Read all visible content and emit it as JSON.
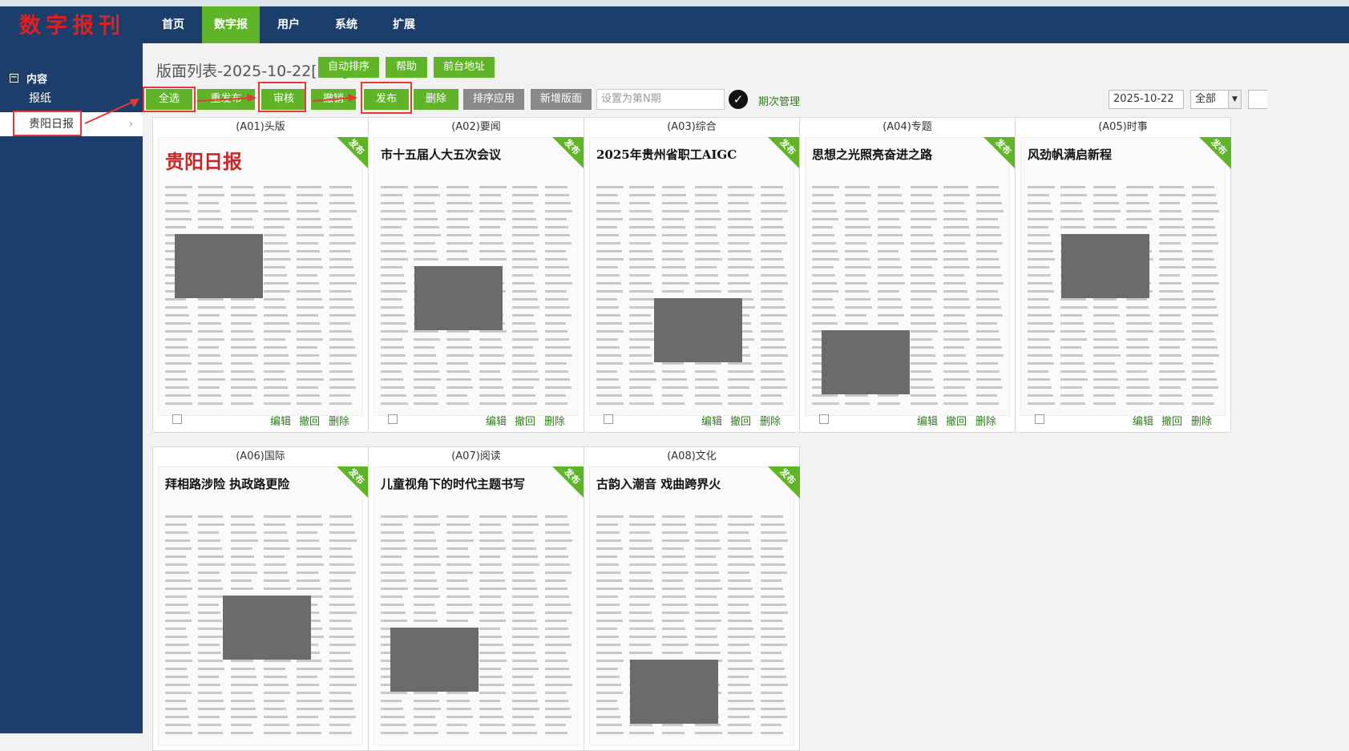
{
  "brand": {
    "logo_text": "数字报刊",
    "accent": "#5fb527",
    "nav_bg": "#1b3e6b"
  },
  "nav": {
    "items": [
      {
        "label": "首页",
        "active": false
      },
      {
        "label": "数字报",
        "active": true
      },
      {
        "label": "用户",
        "active": false
      },
      {
        "label": "系统",
        "active": false
      },
      {
        "label": "扩展",
        "active": false
      }
    ]
  },
  "sidebar": {
    "section_label": "内容",
    "items": [
      {
        "label": "报纸"
      },
      {
        "label": "贵阳日报",
        "active": true
      }
    ]
  },
  "main": {
    "title": "版面列表-2025-10-22[8版]",
    "header_buttons": {
      "auto_sort": "自动排序",
      "help": "帮助",
      "frontend_url": "前台地址"
    },
    "toolbar": {
      "select_all": "全选",
      "resend": "重发布",
      "review": "审核",
      "revoke": "撤销",
      "publish": "发布",
      "delete": "删除",
      "sort_apply": "排序应用",
      "add_page": "新增版面",
      "issue_placeholder": "设置为第N期",
      "issue_manage": "期次管理"
    },
    "filters": {
      "date": "2025-10-22",
      "scope": "全部"
    }
  },
  "card_actions": {
    "edit": "编辑",
    "withdraw": "撤回",
    "delete": "删除",
    "badge": "发布"
  },
  "pages": [
    {
      "title": "(A01)头版",
      "headline": "贵阳日报"
    },
    {
      "title": "(A02)要闻",
      "headline": "市十五届人大五次会议"
    },
    {
      "title": "(A03)综合",
      "headline": "2025年贵州省职工AIGC"
    },
    {
      "title": "(A04)专题",
      "headline": "思想之光照亮奋进之路"
    },
    {
      "title": "(A05)时事",
      "headline": "风劲帆满启新程"
    },
    {
      "title": "(A06)国际",
      "headline": "拜相路涉险 执政路更险"
    },
    {
      "title": "(A07)阅读",
      "headline": "儿童视角下的时代主题书写"
    },
    {
      "title": "(A08)文化",
      "headline": "古韵入潮音 戏曲跨界火"
    }
  ]
}
